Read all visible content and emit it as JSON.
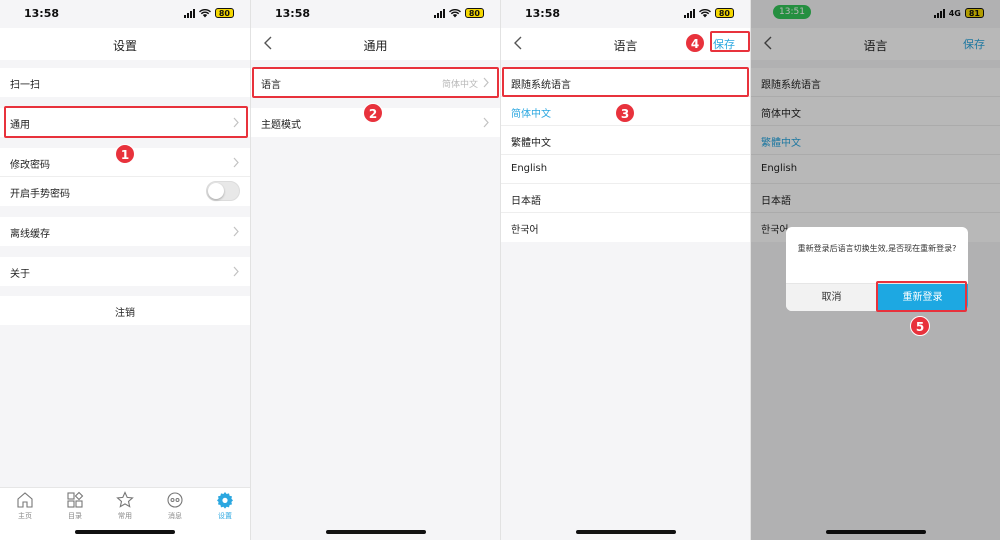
{
  "panel1": {
    "time": "13:58",
    "battery": "80",
    "title": "设置",
    "items": [
      {
        "label": "扫一扫"
      },
      {
        "label": "通用"
      },
      {
        "label": "修改密码"
      },
      {
        "label": "开启手势密码"
      },
      {
        "label": "离线缓存"
      },
      {
        "label": "关于"
      },
      {
        "label": "注销"
      }
    ],
    "tabs": [
      {
        "label": "主页",
        "icon": "home-icon"
      },
      {
        "label": "目录",
        "icon": "catalog-icon"
      },
      {
        "label": "常用",
        "icon": "star-icon"
      },
      {
        "label": "消息",
        "icon": "message-icon"
      },
      {
        "label": "设置",
        "icon": "gear-icon"
      }
    ],
    "step": "1"
  },
  "panel2": {
    "time": "13:58",
    "battery": "80",
    "title": "通用",
    "items": [
      {
        "label": "语言",
        "value": "简体中文"
      },
      {
        "label": "主题模式"
      }
    ],
    "step": "2"
  },
  "panel3": {
    "time": "13:58",
    "battery": "80",
    "title": "语言",
    "save_label": "保存",
    "items": [
      {
        "label": "跟随系统语言"
      },
      {
        "label": "简体中文",
        "selected": true
      },
      {
        "label": "繁體中文"
      },
      {
        "label": "English"
      },
      {
        "label": "日本語"
      },
      {
        "label": "한국어"
      }
    ],
    "step_a": "3",
    "step_b": "4"
  },
  "panel4": {
    "time": "13:51",
    "network": "4G",
    "battery": "81",
    "title": "语言",
    "save_label": "保存",
    "items": [
      {
        "label": "跟随系统语言"
      },
      {
        "label": "简体中文"
      },
      {
        "label": "繁體中文",
        "selected": true
      },
      {
        "label": "English"
      },
      {
        "label": "日本語"
      },
      {
        "label": "한국어"
      }
    ],
    "dialog": {
      "message": "重新登录后语言切换生效,是否现在重新登录?",
      "cancel_label": "取消",
      "confirm_label": "重新登录"
    },
    "step": "5"
  },
  "colors": {
    "accent": "#2ba7e0",
    "highlight": "#e8323c",
    "confirm": "#1da8e2"
  }
}
